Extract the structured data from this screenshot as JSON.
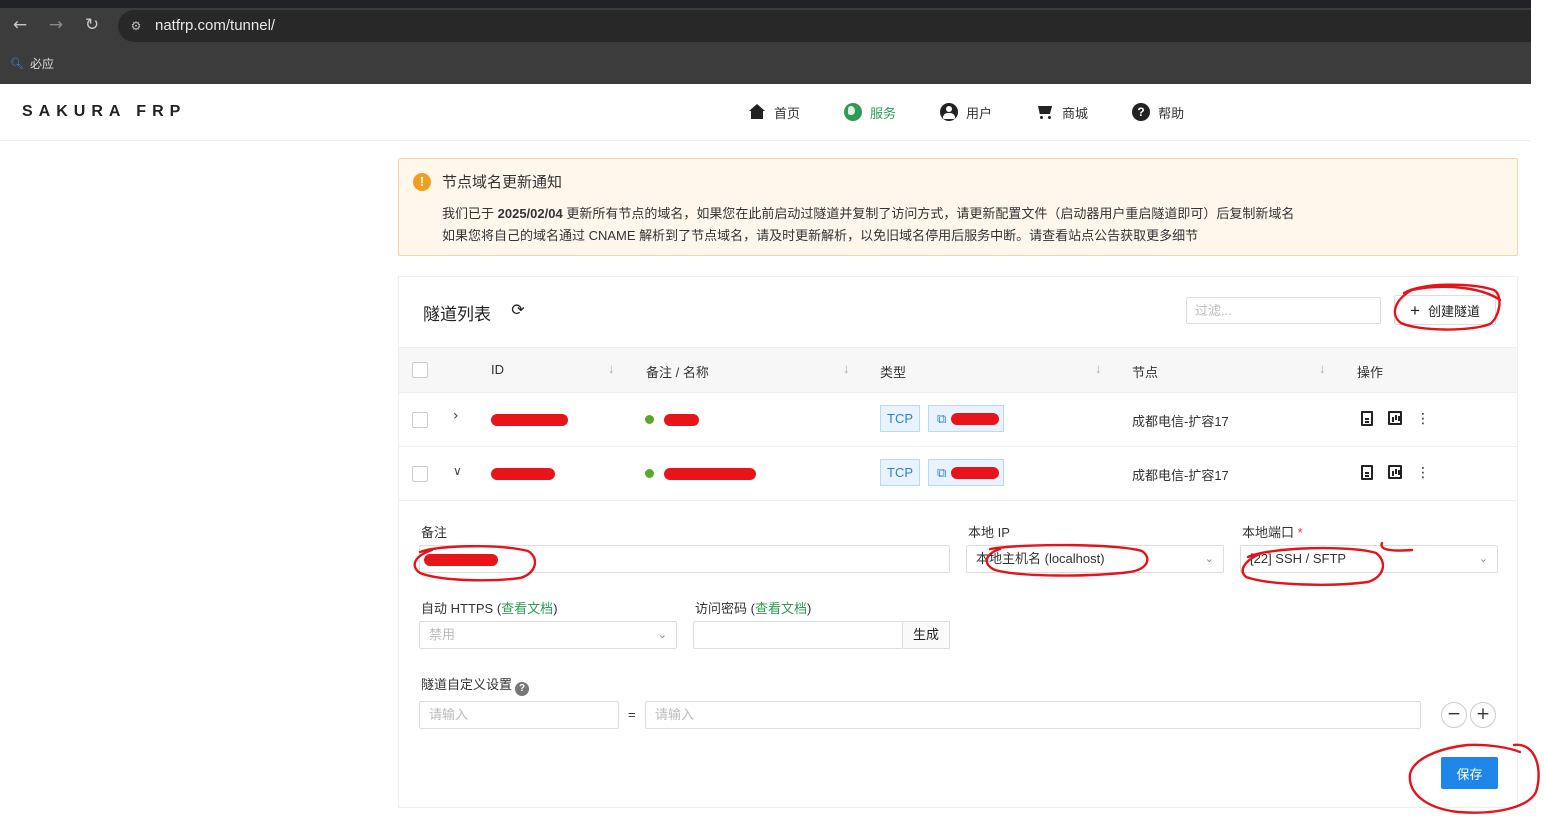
{
  "browser": {
    "url": "natfrp.com/tunnel/",
    "bookmark": "必应"
  },
  "header": {
    "logo": "SAKURA FRP",
    "nav": [
      {
        "label": "首页",
        "icon": "home-icon"
      },
      {
        "label": "服务",
        "icon": "globe-icon",
        "active": true
      },
      {
        "label": "用户",
        "icon": "user-icon"
      },
      {
        "label": "商城",
        "icon": "cart-icon"
      },
      {
        "label": "帮助",
        "icon": "help-icon"
      }
    ]
  },
  "notice": {
    "title": "节点域名更新通知",
    "line1_pre": "我们已于 ",
    "line1_date": "2025/02/04",
    "line1_post": " 更新所有节点的域名，如果您在此前启动过隧道并复制了访问方式，请更新配置文件（启动器用户重启隧道即可）后复制新域名",
    "line2": "如果您将自己的域名通过 CNAME 解析到了节点域名，请及时更新解析，以免旧域名停用后服务中断。请查看站点公告获取更多细节"
  },
  "tunnels": {
    "title": "隧道列表",
    "filter_placeholder": "过滤...",
    "create_label": "创建隧道",
    "columns": [
      "ID",
      "备注 / 名称",
      "类型",
      "节点",
      "操作"
    ],
    "rows": [
      {
        "type": "TCP",
        "node": "成都电信-扩容17"
      },
      {
        "type": "TCP",
        "node": "成都电信-扩容17"
      }
    ]
  },
  "detail": {
    "remark_label": "备注",
    "local_ip_label": "本地 IP",
    "local_ip_value": "本地主机名 (localhost)",
    "local_port_label": "本地端口",
    "local_port_req": "*",
    "local_port_value": "[22] SSH / SFTP",
    "https_label": "自动 HTTPS (",
    "https_link": "查看文档",
    "https_close": ")",
    "https_value": "禁用",
    "pwd_label": "访问密码 (",
    "pwd_link": "查看文档",
    "pwd_close": ")",
    "generate_label": "生成",
    "custom_label": "隧道自定义设置",
    "key_placeholder": "请输入",
    "value_placeholder": "请输入",
    "equals": "=",
    "save_label": "保存"
  }
}
